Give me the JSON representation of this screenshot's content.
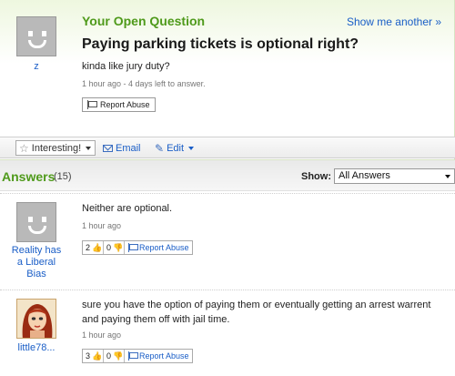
{
  "question": {
    "section_label": "Your Open Question",
    "show_another": "Show me another »",
    "user": "z",
    "title": "Paying parking tickets is optional right?",
    "detail": "kinda like jury duty?",
    "meta": "1 hour ago - 4 days left to answer.",
    "report_label": "Report Abuse"
  },
  "toolbar": {
    "interesting_label": "Interesting!",
    "email_label": "Email",
    "edit_label": "Edit"
  },
  "answers": {
    "title": "Answers",
    "count": "(15)",
    "show_label": "Show:",
    "show_selected": "All Answers",
    "items": [
      {
        "user": "Reality has a Liberal Bias",
        "text": "Neither are optional.",
        "meta": "1 hour ago",
        "thumbs_up": "2",
        "thumbs_down": "0",
        "report_label": "Report Abuse"
      },
      {
        "user": "little78...",
        "text": "sure you have the option of paying them or eventually getting an arrest warrent and paying them off with jail time.",
        "meta": "1 hour ago",
        "thumbs_up": "3",
        "thumbs_down": "0",
        "report_label": "Report Abuse"
      }
    ]
  },
  "colors": {
    "accent_green": "#4f9a1b",
    "link_blue": "#1a5ec7"
  }
}
